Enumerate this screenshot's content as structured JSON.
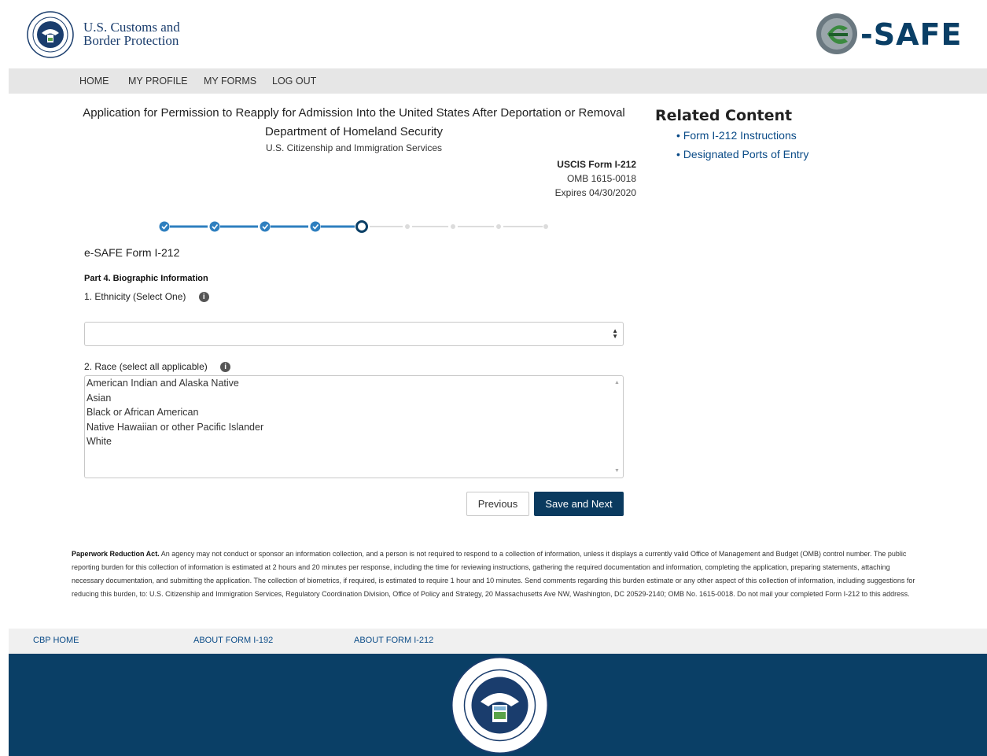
{
  "header": {
    "agency_line1": "U.S. Customs and",
    "agency_line2": "Border Protection",
    "logo_text": "-SAFE"
  },
  "nav": [
    "HOME",
    "MY PROFILE",
    "MY FORMS",
    "LOG OUT"
  ],
  "form_header": {
    "title": "Application for Permission to Reapply for Admission Into the United States After Deportation or Removal",
    "department": "Department of Homeland Security",
    "agency": "U.S. Citizenship and Immigration Services",
    "form_number": "USCIS Form I-212",
    "omb": "OMB 1615-0018",
    "expires": "Expires 04/30/2020"
  },
  "related": {
    "heading": "Related Content",
    "links": [
      "• Form I-212 Instructions",
      "• Designated Ports of Entry"
    ]
  },
  "stepper": {
    "completed": 4,
    "current": 5,
    "total": 9
  },
  "form": {
    "title": "e-SAFE Form I-212",
    "part": "Part 4. Biographic Information",
    "q1_label": "1. Ethnicity (Select One)",
    "q1_value": "",
    "q2_label": "2. Race (select all applicable)",
    "race_options": [
      "American Indian and Alaska Native",
      "Asian",
      "Black or African American",
      "Native Hawaiian or other Pacific Islander",
      "White"
    ]
  },
  "buttons": {
    "previous": "Previous",
    "save_next": "Save and Next"
  },
  "paperwork": {
    "lead": "Paperwork Reduction Act.",
    "text": " An agency may not conduct or sponsor an information collection, and a person is not required to respond to a collection of information, unless it displays a currently valid Office of Management and Budget (OMB) control number.  The public reporting burden for this collection of information is estimated at 2 hours and 20 minutes per response, including the time for reviewing instructions, gathering the required documentation and information, completing the application, preparing statements, attaching necessary documentation, and submitting the application.  The collection of biometrics, if required, is estimated to require 1 hour and 10 minutes.  Send comments regarding this burden estimate or any other aspect of this collection of information, including suggestions for reducing this burden, to:  U.S. Citizenship and Immigration Services, Regulatory Coordination Division, Office of Policy and Strategy, 20 Massachusetts Ave NW, Washington, DC 20529-2140; OMB No. 1615-0018.  Do not mail your completed Form I-212 to this address."
  },
  "footer_links": [
    "CBP HOME",
    "ABOUT FORM I-192",
    "ABOUT FORM I-212"
  ],
  "colors": {
    "navy": "#0a3f66",
    "button": "#0a3a5f",
    "link": "#0a4b87",
    "step_active": "#2e7fbf"
  },
  "icons": {
    "info": "info-icon",
    "seal": "dhs-seal-icon",
    "logo": "esafe-logo-icon"
  }
}
